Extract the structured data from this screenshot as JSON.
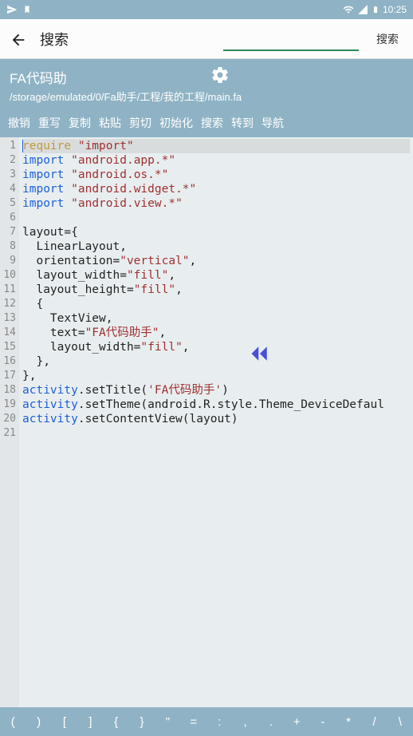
{
  "status": {
    "time": "10:25"
  },
  "search": {
    "label": "搜索",
    "button": "搜索",
    "value": ""
  },
  "header": {
    "title": "FA代码助",
    "path": "/storage/emulated/0/Fa助手/工程/我的工程/main.fa"
  },
  "toolbar": [
    "撤销",
    "重写",
    "复制",
    "粘贴",
    "剪切",
    "初始化",
    "搜索",
    "转到",
    "导航"
  ],
  "code_lines": [
    {
      "n": 1,
      "hl": true,
      "tokens": [
        {
          "t": "kw-req",
          "v": "require"
        },
        {
          "t": "sp",
          "v": " "
        },
        {
          "t": "str",
          "v": "\"import\""
        }
      ]
    },
    {
      "n": 2,
      "tokens": [
        {
          "t": "kw-imp",
          "v": "import"
        },
        {
          "t": "sp",
          "v": " "
        },
        {
          "t": "str",
          "v": "\"android.app.*\""
        }
      ]
    },
    {
      "n": 3,
      "tokens": [
        {
          "t": "kw-imp",
          "v": "import"
        },
        {
          "t": "sp",
          "v": " "
        },
        {
          "t": "str",
          "v": "\"android.os.*\""
        }
      ]
    },
    {
      "n": 4,
      "tokens": [
        {
          "t": "kw-imp",
          "v": "import"
        },
        {
          "t": "sp",
          "v": " "
        },
        {
          "t": "str",
          "v": "\"android.widget.*\""
        }
      ]
    },
    {
      "n": 5,
      "tokens": [
        {
          "t": "kw-imp",
          "v": "import"
        },
        {
          "t": "sp",
          "v": " "
        },
        {
          "t": "str",
          "v": "\"android.view.*\""
        }
      ]
    },
    {
      "n": 6,
      "tokens": []
    },
    {
      "n": 7,
      "tokens": [
        {
          "t": "text-black",
          "v": "layout={"
        }
      ]
    },
    {
      "n": 8,
      "tokens": [
        {
          "t": "text-black",
          "v": "  LinearLayout,"
        }
      ]
    },
    {
      "n": 9,
      "tokens": [
        {
          "t": "text-black",
          "v": "  orientation="
        },
        {
          "t": "str",
          "v": "\"vertical\""
        },
        {
          "t": "text-black",
          "v": ","
        }
      ]
    },
    {
      "n": 10,
      "tokens": [
        {
          "t": "text-black",
          "v": "  layout_width="
        },
        {
          "t": "str",
          "v": "\"fill\""
        },
        {
          "t": "text-black",
          "v": ","
        }
      ]
    },
    {
      "n": 11,
      "tokens": [
        {
          "t": "text-black",
          "v": "  layout_height="
        },
        {
          "t": "str",
          "v": "\"fill\""
        },
        {
          "t": "text-black",
          "v": ","
        }
      ]
    },
    {
      "n": 12,
      "tokens": [
        {
          "t": "text-black",
          "v": "  {"
        }
      ]
    },
    {
      "n": 13,
      "tokens": [
        {
          "t": "text-black",
          "v": "    TextView,"
        }
      ]
    },
    {
      "n": 14,
      "tokens": [
        {
          "t": "text-black",
          "v": "    text="
        },
        {
          "t": "str",
          "v": "\"FA代码助手\""
        },
        {
          "t": "text-black",
          "v": ","
        }
      ]
    },
    {
      "n": 15,
      "tokens": [
        {
          "t": "text-black",
          "v": "    layout_width="
        },
        {
          "t": "str",
          "v": "\"fill\""
        },
        {
          "t": "text-black",
          "v": ","
        }
      ]
    },
    {
      "n": 16,
      "tokens": [
        {
          "t": "text-black",
          "v": "  },"
        }
      ]
    },
    {
      "n": 17,
      "tokens": [
        {
          "t": "text-black",
          "v": "},"
        }
      ]
    },
    {
      "n": 18,
      "tokens": [
        {
          "t": "ident",
          "v": "activity"
        },
        {
          "t": "text-black",
          "v": ".setTitle("
        },
        {
          "t": "str",
          "v": "'FA代码助手'"
        },
        {
          "t": "text-black",
          "v": ")"
        }
      ]
    },
    {
      "n": 19,
      "tokens": [
        {
          "t": "ident",
          "v": "activity"
        },
        {
          "t": "text-black",
          "v": ".setTheme(android.R.style.Theme_DeviceDefaul"
        }
      ]
    },
    {
      "n": 20,
      "tokens": [
        {
          "t": "ident",
          "v": "activity"
        },
        {
          "t": "text-black",
          "v": ".setContentView(layout)"
        }
      ]
    },
    {
      "n": 21,
      "tokens": []
    }
  ],
  "symbols": [
    "(",
    ")",
    "[",
    "]",
    "{",
    "}",
    "\"",
    "=",
    ":",
    ",",
    ".",
    "+",
    "-",
    "*",
    "/",
    "\\"
  ]
}
